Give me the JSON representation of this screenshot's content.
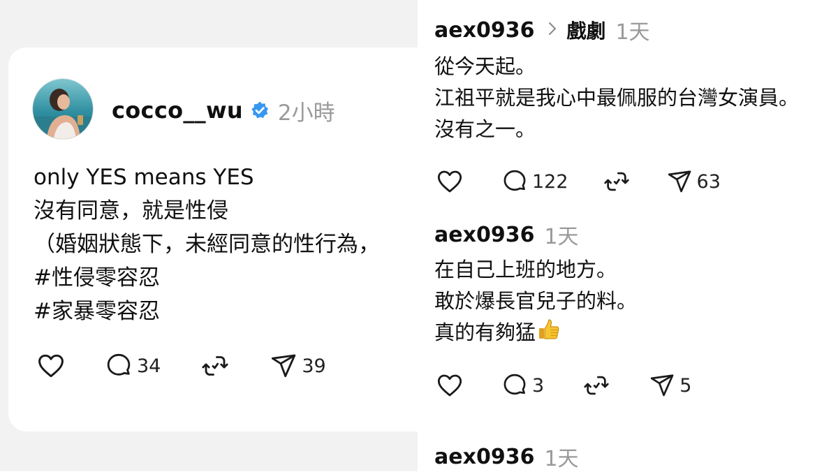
{
  "post": {
    "username": "cocco__wu",
    "time": "2小時",
    "lines": [
      "only YES means YES",
      "沒有同意，就是性侵",
      "（婚姻狀態下，未經同意的性行為，",
      "#性侵零容忍",
      "#家暴零容忍"
    ],
    "replies": "34",
    "shares": "39"
  },
  "comments": [
    {
      "username": "aex0936",
      "topic": "戲劇",
      "time": "1天",
      "lines": [
        "從今天起。",
        "江祖平就是我心中最佩服的台灣女演員。",
        "沒有之一。"
      ],
      "replies": "122",
      "shares": "63"
    },
    {
      "username": "aex0936",
      "time": "1天",
      "lines": [
        "在自己上班的地方。",
        "敢於爆長官兒子的料。",
        "真的有夠猛"
      ],
      "emoji": "thumbs-up-emoji",
      "replies": "3",
      "shares": "5"
    },
    {
      "username": "aex0936",
      "time": "1天"
    }
  ],
  "icons": {
    "like": "heart-icon",
    "reply": "reply-icon",
    "repost": "repost-icon",
    "share": "share-icon",
    "verified": "verified-badge-icon"
  },
  "colors": {
    "verified": "#3897f0",
    "muted_text": "#9a9a9a",
    "icon": "#1a1a1a"
  }
}
